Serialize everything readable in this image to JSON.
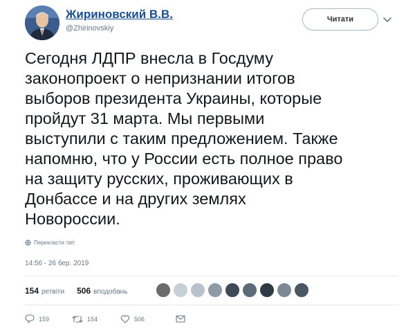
{
  "author": {
    "display_name": "Жириновский В.В.",
    "handle": "@Zhirinovskiy",
    "avatar_icon": "user-avatar"
  },
  "follow_button": {
    "label": "Читати"
  },
  "tweet": {
    "lines": [
      "Сегодня ЛДПР внесла в Госдуму",
      "законопроект о непризнании итогов",
      "выборов президента Украины, которые",
      "пройдут 31 марта. Мы первыми",
      "выступили с таким предложением. Также",
      "напомню, что у России есть полное право",
      "на защиту русских, проживающих в",
      "Донбассе и на других землях",
      "Новороссии."
    ],
    "translate_label": "Перекласти твіт",
    "timestamp": "14:56 - 26 бер. 2019"
  },
  "stats": {
    "retweets_count": "154",
    "retweets_label": "ретвіти",
    "likes_count": "506",
    "likes_label": "вподобань"
  },
  "actions": {
    "reply_count": "159",
    "retweet_count": "154",
    "like_count": "506"
  },
  "colors": {
    "name_link": "#1d4f8f",
    "secondary_text": "#657786",
    "divider": "#e1e8ed"
  }
}
